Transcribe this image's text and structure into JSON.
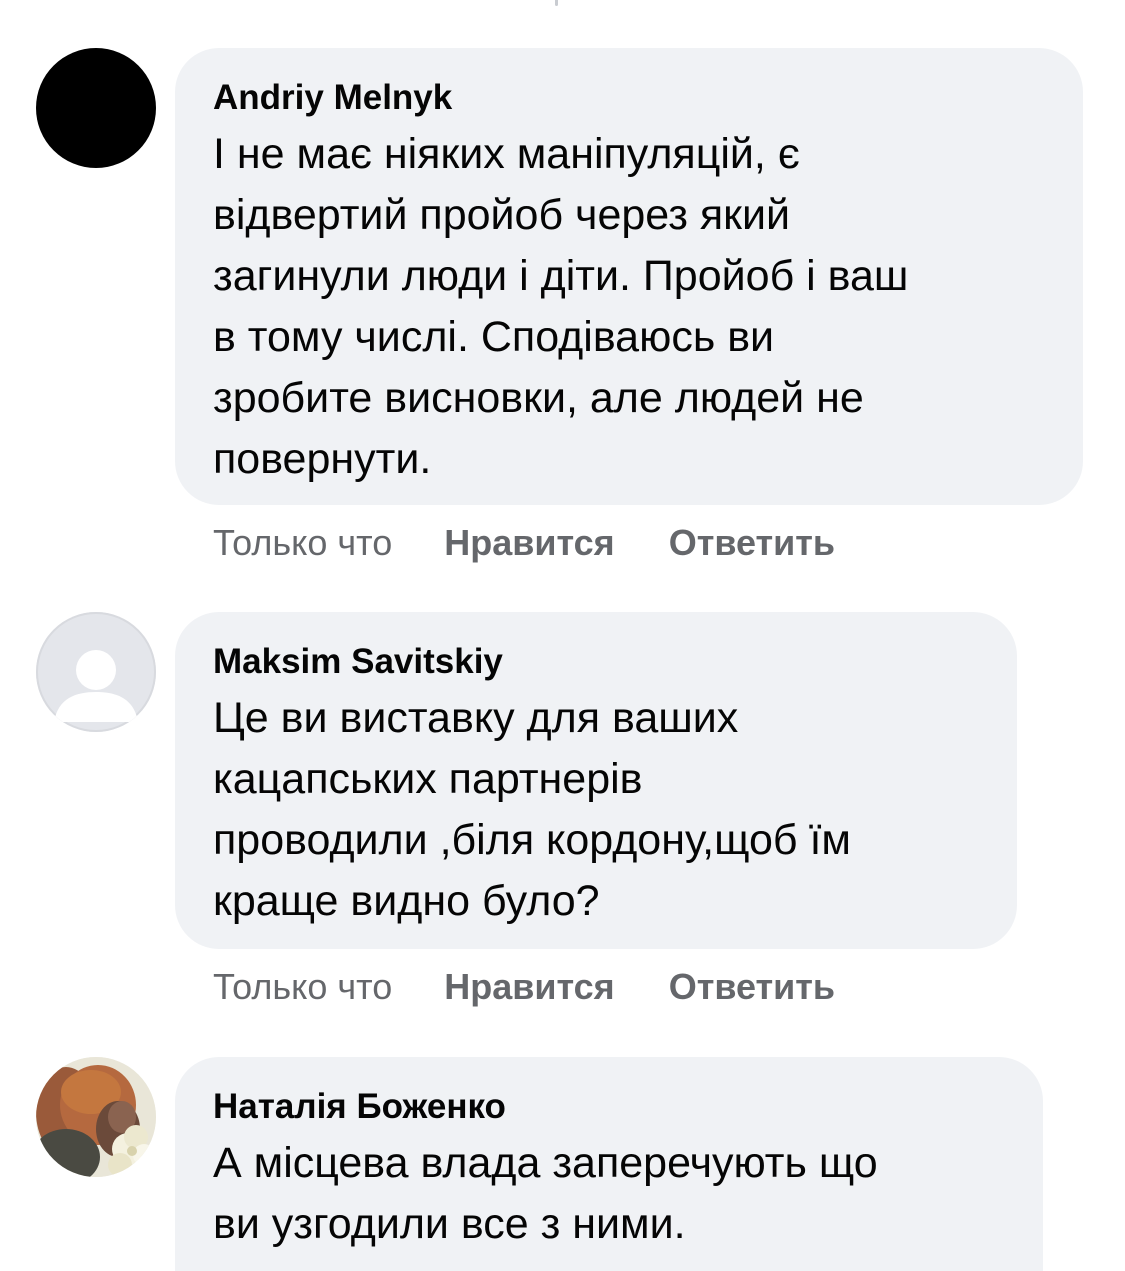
{
  "comments": [
    {
      "author": "Andriy Melnyk",
      "avatar": "black-avatar",
      "text": "І не має ніяких маніпуляцій, є\nвідвертий пройоб через який\nзагинули люди і діти. Пройоб і ваш\nв тому числі. Сподіваюсь ви\nзробите висновки, але людей не\nповернути.",
      "time": "Только что",
      "like_label": "Нравится",
      "reply_label": "Ответить"
    },
    {
      "author": "Maksim Savitskiy",
      "avatar": "default-profile-icon",
      "text": "Це ви виставку для ваших\nкацапських партнерів\nпроводили ,біля кордону,щоб їм\nкраще видно було?",
      "time": "Только что",
      "like_label": "Нравится",
      "reply_label": "Ответить"
    },
    {
      "author": "Наталія Боженко",
      "avatar": "profile-photo",
      "text": "А місцева влада заперечують що\nви узгодили все з ними."
    }
  ],
  "colors": {
    "bubble": "#f0f2f5",
    "text": "#050505",
    "meta": "#65676b"
  }
}
